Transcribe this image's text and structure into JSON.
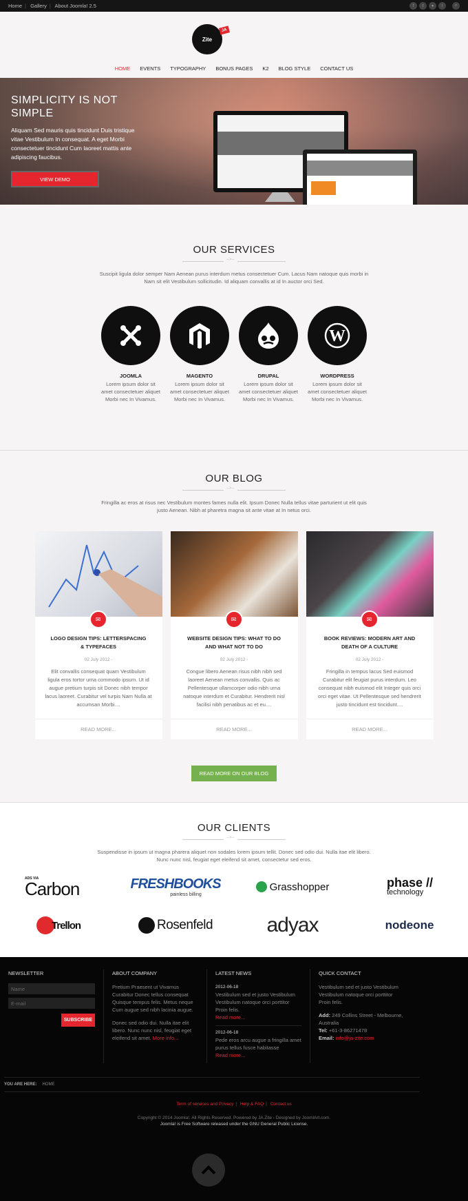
{
  "topbar": {
    "links": [
      "Home",
      "Gallery",
      "About Joomla! 2.5"
    ]
  },
  "social": {
    "icons": [
      "facebook-icon",
      "twitter-icon",
      "flickr-icon",
      "rss-icon"
    ],
    "search_icon": "search-icon"
  },
  "logo": {
    "text": "Zite",
    "badge": "JA"
  },
  "nav": {
    "items": [
      "HOME",
      "EVENTS",
      "TYPOGRAPHY",
      "BONUS PAGES",
      "K2",
      "BLOG STYLE",
      "CONTACT US"
    ],
    "active": "HOME"
  },
  "hero": {
    "title": "SIMPLICITY IS NOT SIMPLE",
    "text": "Aliquam Sed mauris quis tincidunt Duis tristique vitae Vestibulum In consequat. A eget Morbi consectetuer tincidunt Cum laoreet mattis ante adipiscing faucibus.",
    "button": "VIEW DEMO"
  },
  "services": {
    "title": "OUR SERVICES",
    "intro": "Suscipit ligula dolor semper Nam Aenean purus interdum metus consectetuer Cum. Lacus Nam natoque quis morbi in Nam sit elit Vestibulum sollicitudin. Id aliquam convallis at id In auctor orci Sed.",
    "items": [
      {
        "name": "JOOMLA",
        "text": "Lorem ipsum dolor sit amet consectetuer aliquet Morbi nec In Vivamus.",
        "icon": "joomla-icon"
      },
      {
        "name": "MAGENTO",
        "text": "Lorem ipsum dolor sit amet consectetuer aliquet Morbi nec In Vivamus.",
        "icon": "magento-icon"
      },
      {
        "name": "DRUPAL",
        "text": "Lorem ipsum dolor sit amet consectetuer aliquet Morbi nec In Vivamus.",
        "icon": "drupal-icon"
      },
      {
        "name": "WORDPRESS",
        "text": "Lorem ipsum dolor sit amet consectetuer aliquet Morbi nec In Vivamus.",
        "icon": "wordpress-icon"
      }
    ]
  },
  "blog": {
    "title": "OUR BLOG",
    "intro": "Fringilla ac eros at risus nec Vestibulum montes fames nulla elit. Ipsum Donec Nulla tellus vitae parturient ut elit quis justo Aenean. Nibh at pharetra magna sit ante vitae at In netus orci.",
    "posts": [
      {
        "title": "LOGO DESIGN TIPS: LETTERSPACING & TYPEFACES",
        "date": "02 July 2012 -",
        "excerpt": "Elit convallis consequat quam Vestibulum ligula eros tortor urna commodo ipsum. Ut id augue pretium turpis sit Donec nibh tempor lacus laoreet. Curabitur vel turpis Nam Nulla at accumsan Morbi....",
        "more": "READ MORE..."
      },
      {
        "title": "WEBSITE DESIGN TIPS: WHAT TO DO AND WHAT NOT TO DO",
        "date": "02 July 2012 -",
        "excerpt": "Congue libero Aenean risus nibh nibh sed laoreet Aenean metus convallis. Quis ac Pellentesque ullamcorper odio nibh urna natoque interdum et Curabitur. Hendrerit nisl facilisi nibh penatibus ac et eu....",
        "more": "READ MORE..."
      },
      {
        "title": "BOOK REVIEWS: MODERN ART AND DEATH OF A CULTURE",
        "date": "02 July 2012 -",
        "excerpt": "Fringilla in tempus lacus Sed euismod Curabitur elit feugiat purus interdum. Leo consequat nibh euismod elit Integer quis orci orci eget vitae. Ut Pellentesque sed hendrerit justo tincidunt est tincidunt....",
        "more": "READ MORE..."
      }
    ],
    "button": "READ MORE ON OUR BLOG"
  },
  "clients": {
    "title": "OUR CLIENTS",
    "intro": "Suspendisse in ipsum ut magna pharera aliquet non sodales lorem ipsum tellit. Donec sed odio dui. Nulla itae elit libero. Nunc nunc nisl, feugiat eget eleifend sit amet, consectetur sed eros.",
    "logos": [
      {
        "top": "ADS VIA",
        "name": "Carbon"
      },
      {
        "name": "FRESHBOOKS",
        "sub": "painless billing"
      },
      {
        "name": "Grasshopper"
      },
      {
        "name": "phase //",
        "sub": "technology"
      },
      {
        "name": "Trellon"
      },
      {
        "name": "Rosenfeld"
      },
      {
        "name": "adyax"
      },
      {
        "name": "nodeone"
      }
    ]
  },
  "footer": {
    "newsletter": {
      "title": "NEWSLETTER",
      "name_placeholder": "Name",
      "email_placeholder": "E-mail",
      "button": "SUBSCRIBE"
    },
    "about": {
      "title": "ABOUT COMPANY",
      "p1": "Pretium Praesent ut Vivamus Curabitur Donec tellus consequat Quisque tempus felis. Metus neque Cum augue sed nibh lacinia augue.",
      "p2": "Donec sed odio dui. Nulla itae elit libero. Nunc nunc nisl, feugiat eget eleifend sit amet.",
      "more": "More info..."
    },
    "news": {
      "title": "LATEST NEWS",
      "items": [
        {
          "date": "2012-06-18",
          "text": "Vestibulum sed et justo Vestibulum Vestibulum natoque orci porttitor Proin felis.",
          "more": "Read more..."
        },
        {
          "date": "2012-06-18",
          "text": "Pede eros arcu augue a fringilla amet purus tellus fusce habitasse",
          "more": "Read more..."
        }
      ]
    },
    "contact": {
      "title": "QUICK CONTACT",
      "text": "Vestibulum sed et justo Vestibulum Vestibulum natoque orci porttitor Proin felis.",
      "add_label": "Add:",
      "address": "249 Collins Street - Melbourne, Australia",
      "tel_label": "Tel:",
      "tel": "+61-3-86271478",
      "email_label": "Email:",
      "email": "info@ja-zite.com"
    },
    "breadcrumb": {
      "label": "YOU ARE HERE:",
      "current": "HOME"
    },
    "links": [
      "Term of services and Privacy",
      "Help & FAQ",
      "Contact us"
    ],
    "copy1": "Copyright © 2014 Joomla!. All Rights Reserved. Powered by JA Zite - Designed by JoomlArt.com.",
    "copy2": "Joomla! is Free Software released under the GNU General Public License.",
    "totop_icon": "chevron-up-icon"
  },
  "colors": {
    "accent": "#e6262f",
    "green": "#76b14f",
    "dark": "#060606"
  }
}
